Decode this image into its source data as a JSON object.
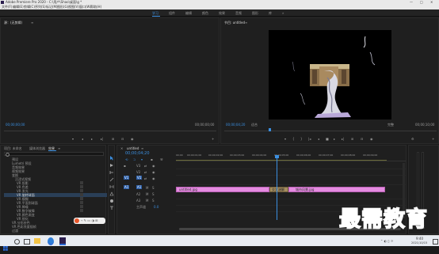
{
  "titlebar": {
    "title": "Adobe Premiere Pro 2020 - C:\\用户\\Shao\\桌面\\g *"
  },
  "menubar": [
    "文件(F)",
    "编辑(E)",
    "剪辑(C)",
    "序列(S)",
    "标记(M)",
    "图形(G)",
    "视图(V)",
    "窗口(W)",
    "帮助(H)"
  ],
  "workspaces": [
    "学习",
    "组件",
    "编辑",
    "颜色",
    "效果",
    "音频",
    "图形",
    "库"
  ],
  "source_panel": {
    "title": "源：(无剪辑)",
    "timecode_left": "00;00;00;00",
    "timecode_right": "00;00;00;00"
  },
  "program_panel": {
    "title": "节目: untitled",
    "timecode": "00;00;04;20",
    "fit_label": "适合",
    "scale_label": "完整",
    "duration": "00;00;10;00"
  },
  "effects_panel": {
    "tabs": [
      "项目: 未命名",
      "媒体浏览器",
      "效果"
    ],
    "items": [
      {
        "label": "预设"
      },
      {
        "label": "Lumetri 预设"
      },
      {
        "label": "音频效果"
      },
      {
        "label": "视频效果"
      },
      {
        "label": "变换"
      },
      {
        "label": "沉浸式视频"
      },
      {
        "label": "VR 投影"
      },
      {
        "label": "VR 色差"
      },
      {
        "label": "VR 发光"
      },
      {
        "label": "VR 旋转球面",
        "selected": true
      },
      {
        "label": "VR 模糊"
      },
      {
        "label": "VR 平面到球面"
      },
      {
        "label": "VR 降噪"
      },
      {
        "label": "VR 数字故障"
      },
      {
        "label": "VR 颜色渐变"
      },
      {
        "label": "VR 锐化"
      },
      {
        "label": "VR 分形杂色"
      },
      {
        "label": "VR 色彩亮度插帧"
      },
      {
        "label": "过渡"
      },
      {
        "label": "模糊"
      },
      {
        "label": "视频过渡"
      }
    ]
  },
  "timeline": {
    "tab": "untitled",
    "timecode": "00;00;04;20",
    "ruler": [
      "00;00",
      "00;00;01;00",
      "00;00;02;00",
      "00;00;03;00",
      "00;00;04;00",
      "00;00;05;00",
      "00;00;06;00",
      "00;00;07;00",
      "00;00;08;00",
      "00;00;09;00"
    ],
    "tracks": [
      "V3",
      "V2",
      "V1",
      "A1",
      "A2",
      "A3"
    ],
    "master_label": "主声道",
    "master_value": "0.0",
    "clips": [
      {
        "label": "untitled.jpg"
      },
      {
        "label": "交叉溶解"
      },
      {
        "label": "城市风景.jpg"
      }
    ]
  },
  "watermark": {
    "text": "最需教育"
  },
  "taskbar": {
    "time": "9:40",
    "date": "2021/10/15"
  },
  "colors": {
    "accent": "#3b8fe0",
    "clip": "#e48be0",
    "playhead": "#3b8fe0"
  }
}
